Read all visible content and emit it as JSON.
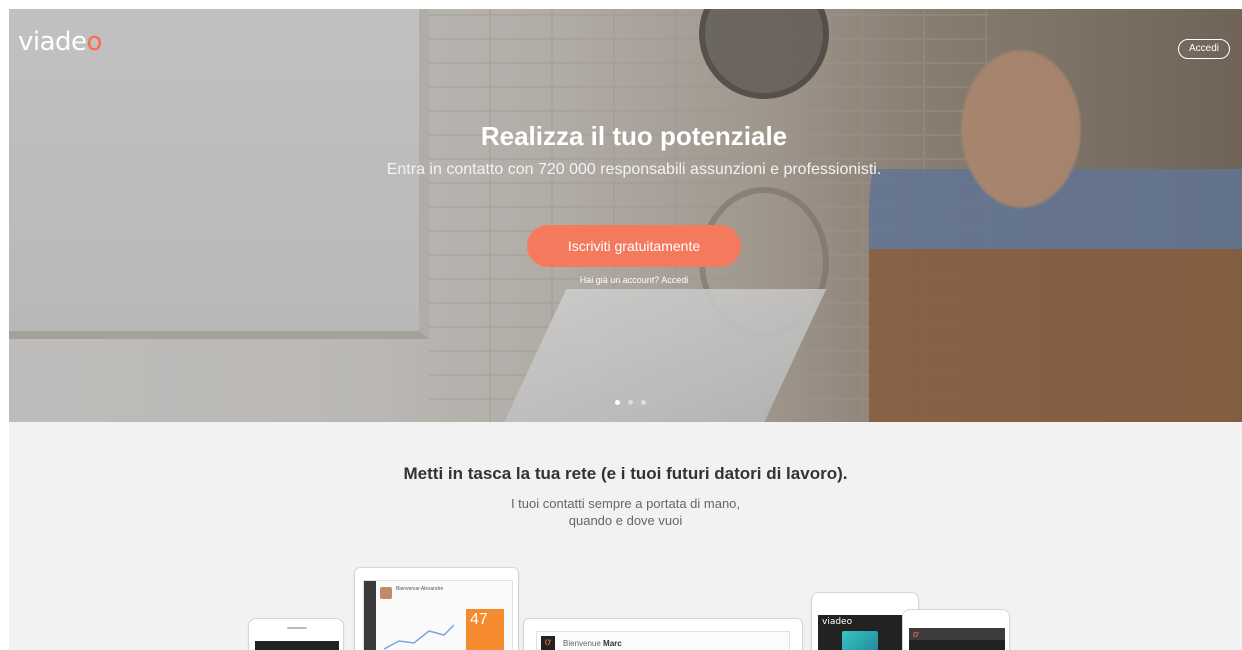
{
  "header": {
    "logo_text": "viadeo",
    "signin_label": "Accedi"
  },
  "hero": {
    "title": "Realizza il tuo potenziale",
    "subtitle": "Entra in contatto con 720 000 responsabili assunzioni e professionisti.",
    "cta_label": "Iscriviti gratuitamente",
    "login_prompt": "Hai già un account? Accedi",
    "carousel_active_index": 0,
    "carousel_count": 3
  },
  "section": {
    "title": "Metti in tasca la tua rete (e i tuoi futuri datori di lavoro).",
    "subtitle_line1": "I tuoi contatti sempre a portata di mano,",
    "subtitle_line2": "quando e dove vuoi"
  },
  "devices": {
    "tablet_welcome": "Bienvenue Alexandre",
    "tablet_number": "47",
    "desktop_welcome_prefix": "Bienvenue",
    "desktop_welcome_name": "Marc",
    "phone_brand": "viadeo"
  },
  "colors": {
    "accent": "#f57a5d",
    "logo_mark": "#ff6b4a",
    "stat_orange": "#f58a2f"
  }
}
